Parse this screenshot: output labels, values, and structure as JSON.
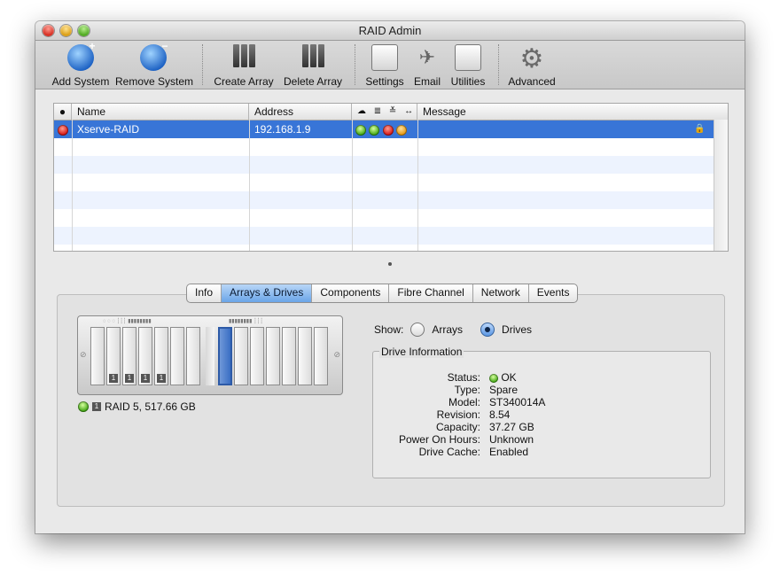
{
  "window": {
    "title": "RAID Admin"
  },
  "toolbar": {
    "items": [
      {
        "label": "Add System",
        "icon": "add-system-globe-icon"
      },
      {
        "label": "Remove System",
        "icon": "remove-system-globe-icon"
      },
      {
        "label": "Create Array",
        "icon": "create-array-drives-icon"
      },
      {
        "label": "Delete Array",
        "icon": "delete-array-drives-icon"
      },
      {
        "label": "Settings",
        "icon": "settings-switch-icon"
      },
      {
        "label": "Email",
        "icon": "email-paper-plane-icon"
      },
      {
        "label": "Utilities",
        "icon": "utilities-drive-stethoscope-icon"
      },
      {
        "label": "Advanced",
        "icon": "advanced-gear-icon"
      }
    ]
  },
  "systems_table": {
    "columns": [
      "Name",
      "Address",
      "Message"
    ],
    "status_column_icons": [
      "status-dot-header",
      "status-icon-1",
      "status-icon-2",
      "status-icon-3",
      "status-icon-4"
    ],
    "rows": [
      {
        "status": "red",
        "name": "Xserve-RAID",
        "address": "192.168.1.9",
        "indicators": [
          "green",
          "green",
          "red",
          "orange"
        ],
        "message": ""
      }
    ]
  },
  "tabs": [
    "Info",
    "Arrays & Drives",
    "Components",
    "Fibre Channel",
    "Network",
    "Events"
  ],
  "active_tab": "Arrays & Drives",
  "arrays_panel": {
    "drive_numbers": [
      "1",
      "1",
      "1",
      "1"
    ],
    "array_summary": {
      "number": "1",
      "text": "RAID 5, 517.66 GB",
      "status": "green"
    }
  },
  "show": {
    "label": "Show:",
    "options": [
      "Arrays",
      "Drives"
    ],
    "selected": "Drives"
  },
  "drive_information": {
    "title": "Drive Information",
    "rows": [
      {
        "key": "Status:",
        "value": "OK"
      },
      {
        "key": "Type:",
        "value": "Spare"
      },
      {
        "key": "Model:",
        "value": "ST340014A"
      },
      {
        "key": "Revision:",
        "value": "8.54"
      },
      {
        "key": "Capacity:",
        "value": "37.27 GB"
      },
      {
        "key": "Power On Hours:",
        "value": "Unknown"
      },
      {
        "key": "Drive Cache:",
        "value": "Enabled"
      }
    ],
    "status_color": "green"
  },
  "colors": {
    "selection": "#3875d7",
    "active_tab": "#6aa5e8"
  }
}
